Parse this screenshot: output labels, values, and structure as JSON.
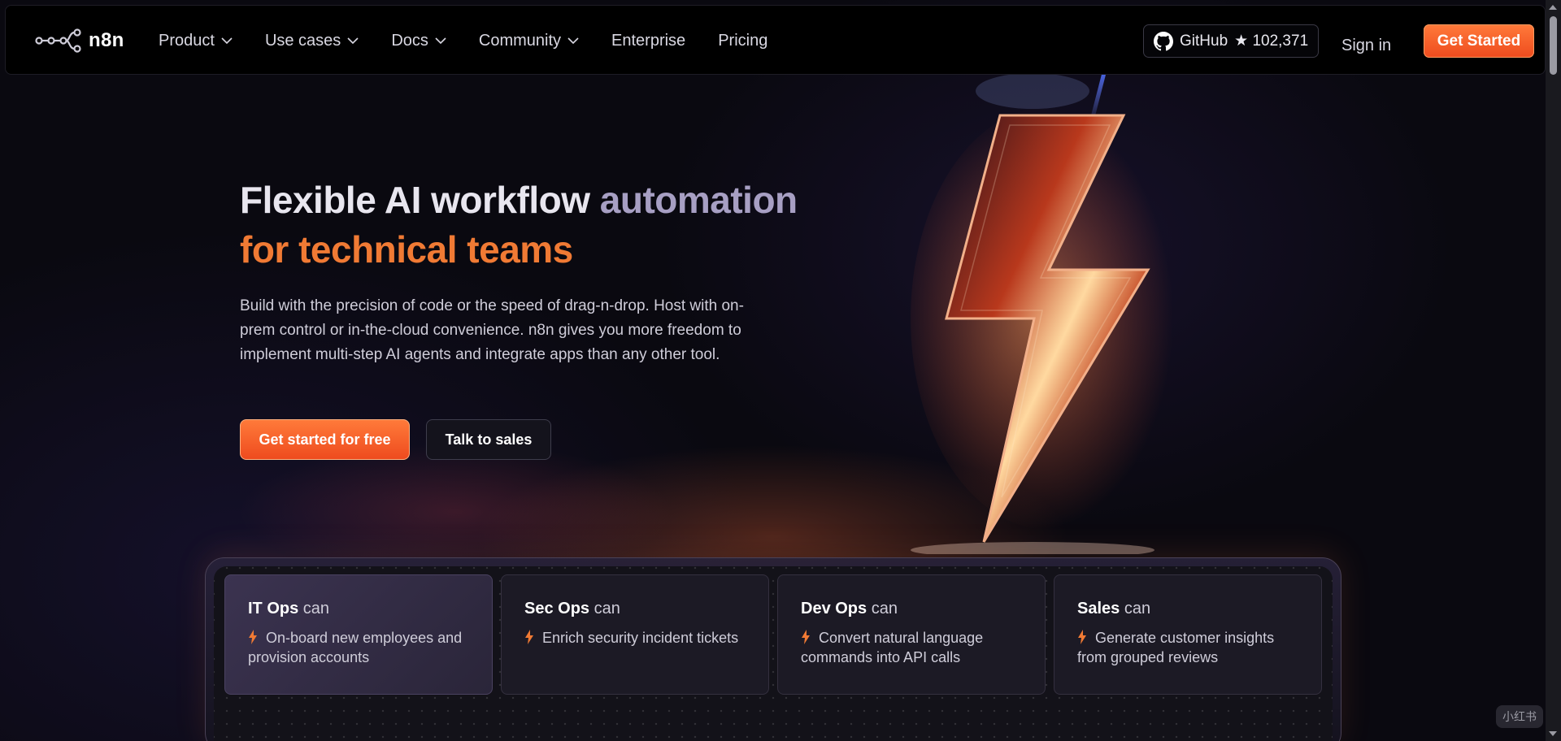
{
  "nav": {
    "logo_text": "n8n",
    "links": [
      {
        "label": "Product",
        "dropdown": true
      },
      {
        "label": "Use cases",
        "dropdown": true
      },
      {
        "label": "Docs",
        "dropdown": true
      },
      {
        "label": "Community",
        "dropdown": true
      },
      {
        "label": "Enterprise",
        "dropdown": false
      },
      {
        "label": "Pricing",
        "dropdown": false
      }
    ],
    "github_label": "GitHub",
    "github_stars": "★ 102,371",
    "signin": "Sign in",
    "get_started": "Get Started"
  },
  "hero": {
    "title_part1": "Flexible AI workflow ",
    "title_part2": "automation",
    "title_part3": "for technical teams",
    "description": "Build with the precision of code or the speed of drag-n-drop. Host with on-prem control or in-the-cloud convenience. n8n gives you more freedom to implement multi-step AI agents and integrate apps than any other tool.",
    "primary_cta": "Get started for free",
    "secondary_cta": "Talk to sales"
  },
  "cards": [
    {
      "role": "IT Ops",
      "suffix": "can",
      "text": "On-board new employees and provision accounts"
    },
    {
      "role": "Sec Ops",
      "suffix": "can",
      "text": "Enrich security incident tickets"
    },
    {
      "role": "Dev Ops",
      "suffix": "can",
      "text": "Convert natural language commands into API calls"
    },
    {
      "role": "Sales",
      "suffix": "can",
      "text": "Generate customer insights from grouped reviews"
    }
  ],
  "watermark": "小红书",
  "colors": {
    "accent": "#ee4b1e",
    "title_highlight": "#f07a34",
    "title_muted": "#a79fc3"
  }
}
